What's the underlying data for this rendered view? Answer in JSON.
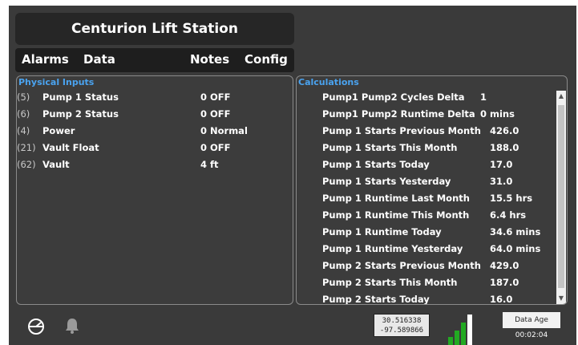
{
  "app": {
    "title": "Centurion Lift Station"
  },
  "menu": {
    "alarms": "Alarms",
    "data": "Data",
    "notes": "Notes",
    "config": "Config"
  },
  "physical_inputs": {
    "header": "Physical Inputs",
    "rows": [
      {
        "code": "(5)",
        "name": "Pump 1 Status",
        "value": "0 OFF"
      },
      {
        "code": "(6)",
        "name": "Pump 2 Status",
        "value": "0 OFF"
      },
      {
        "code": "(4)",
        "name": "Power",
        "value": "0 Normal"
      },
      {
        "code": "(21)",
        "name": "Vault Float",
        "value": "0 OFF"
      },
      {
        "code": "(62)",
        "name": "Vault",
        "value": "4 ft"
      }
    ]
  },
  "calculations": {
    "header": "Calculations",
    "rows": [
      {
        "name": "Pump1 Pump2 Cycles Delta",
        "value": "1"
      },
      {
        "name": "Pump1 Pump2 Runtime Delta",
        "value": "0 mins"
      },
      {
        "name": "Pump 1 Starts Previous Month",
        "value": "426.0"
      },
      {
        "name": "Pump 1 Starts This Month",
        "value": "188.0"
      },
      {
        "name": "Pump 1 Starts Today",
        "value": "17.0"
      },
      {
        "name": "Pump 1 Starts Yesterday",
        "value": "31.0"
      },
      {
        "name": "Pump 1 Runtime Last Month",
        "value": "15.5 hrs"
      },
      {
        "name": "Pump 1 Runtime This Month",
        "value": "6.4 hrs"
      },
      {
        "name": "Pump 1 Runtime Today",
        "value": "34.6 mins"
      },
      {
        "name": "Pump 1 Runtime Yesterday",
        "value": "64.0 mins"
      },
      {
        "name": "Pump 2 Starts Previous Month",
        "value": "429.0"
      },
      {
        "name": "Pump 2 Starts This Month",
        "value": "187.0"
      },
      {
        "name": "Pump 2 Starts Today",
        "value": "16.0"
      }
    ]
  },
  "status": {
    "latitude": "30.516338",
    "longitude": "-97.589866",
    "data_age_label": "Data Age",
    "data_age_value": "00:02:04",
    "icons": [
      "gauge-icon",
      "bell-icon",
      "signal-strength-icon"
    ]
  },
  "colors": {
    "background": "#3a3a3a",
    "panel_header": "#4aa3f0",
    "signal_green": "#22aa22"
  }
}
